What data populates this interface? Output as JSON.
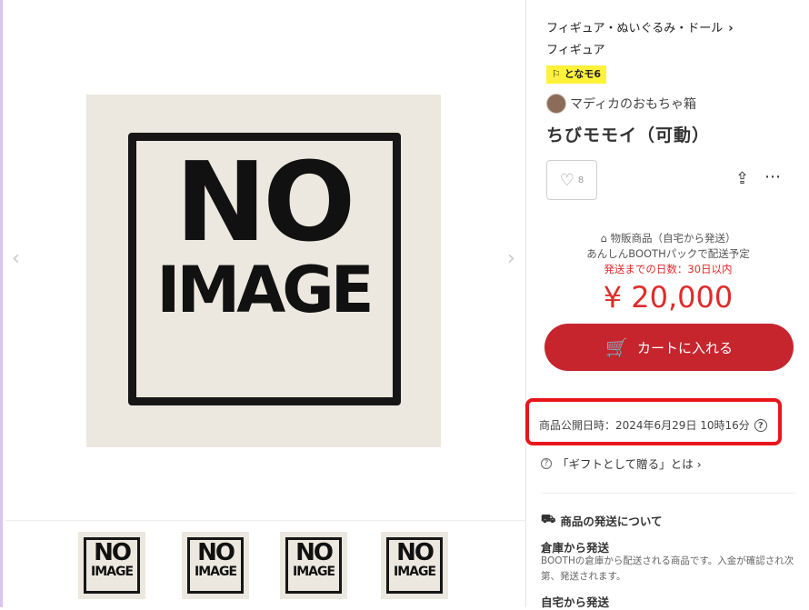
{
  "gallery": {
    "main_image_line1": "NO",
    "main_image_line2": "IMAGE",
    "prev_arrow": "‹",
    "next_arrow": "›",
    "thumbnails": [
      {
        "line1": "NO",
        "line2": "IMAGE"
      },
      {
        "line1": "NO",
        "line2": "IMAGE"
      },
      {
        "line1": "NO",
        "line2": "IMAGE"
      },
      {
        "line1": "NO",
        "line2": "IMAGE"
      }
    ]
  },
  "product": {
    "breadcrumb1": "フィギュア・ぬいぐるみ・ドール",
    "breadcrumb_chevron": "›",
    "breadcrumb2": "フィギュア",
    "tag": "⚐ となモ6",
    "shop_name": "マディカのおもちゃ箱",
    "title": "ちびモモイ（可動）",
    "like_count": "8",
    "like_icon": "heart-outline-icon",
    "ship_type": "物販商品（自宅から発送）",
    "ship_pack": "あんしんBOOTHパックで配送予定",
    "ship_days": "発送までの日数：30日以内",
    "price": "¥ 20,000",
    "cart_label": "カートに入れる",
    "published": "商品公開日時：2024年6月29日 10時16分",
    "gift_link": "「ギフトとして贈る」とは ›",
    "delivery_heading": "商品の発送について",
    "warehouse_title": "倉庫から発送",
    "warehouse_desc": "BOOTHの倉庫から配送される商品です。入金が確認され次第、発送されます。",
    "home_title": "自宅から発送"
  },
  "colors": {
    "accent_red": "#c6252e",
    "price_red": "#e02b2b",
    "highlight_box": "#e8161b",
    "tag_yellow": "#fff23a"
  }
}
